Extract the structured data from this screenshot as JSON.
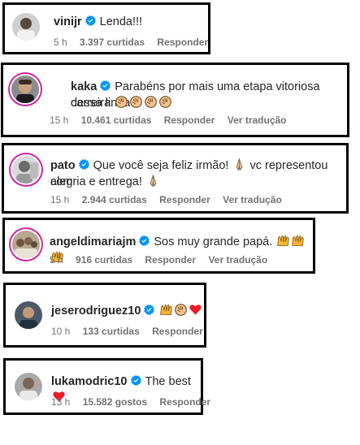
{
  "colors": {
    "verified": "#0095f6",
    "meta_text": "#737373",
    "story_ring": "#d6249f",
    "heart": "#ed1c24"
  },
  "comments": [
    {
      "username": "vinijr",
      "text": "Lenda!!!",
      "time": "5 h",
      "likes": "3.397 curtidas",
      "reply": "Responder",
      "translate": ""
    },
    {
      "username": "kaka",
      "text_line1": "Parabéns por mais uma etapa vitoriosa dessa linda",
      "text_line2": "carreira",
      "emojis": [
        "clap-emoji",
        "clap-emoji",
        "clap-emoji",
        "clap-emoji"
      ],
      "time": "15 h",
      "likes": "10.461 curtidas",
      "reply": "Responder",
      "translate": "Ver tradução"
    },
    {
      "username": "pato",
      "text_line1": "Que você seja feliz irmão!",
      "text_line1b": "vc representou com",
      "text_line2": "alegria e entrega!",
      "emojis": [
        "pray-emoji",
        "pray-emoji"
      ],
      "time": "15 h",
      "likes": "2.944 curtidas",
      "reply": "Responder",
      "translate": "Ver tradução"
    },
    {
      "username": "angeldimariajm",
      "text": "Sos muy grande papá.",
      "emojis": [
        "raised-hands-emoji",
        "raised-hands-emoji",
        "raised-hands-emoji"
      ],
      "time": "5 h",
      "likes": "916 curtidas",
      "reply": "Responder",
      "translate": "Ver tradução"
    },
    {
      "username": "jeserodriguez10",
      "text": "",
      "emojis": [
        "raised-hands-emoji",
        "clap-emoji",
        "heart-emoji"
      ],
      "time": "10 h",
      "likes": "133 curtidas",
      "reply": "Responder",
      "translate": ""
    },
    {
      "username": "lukamodric10",
      "text": "The best",
      "emojis": [
        "heart-emoji"
      ],
      "time": "13 h",
      "likes": "15.582 gostos",
      "reply": "Responder",
      "translate": ""
    }
  ]
}
